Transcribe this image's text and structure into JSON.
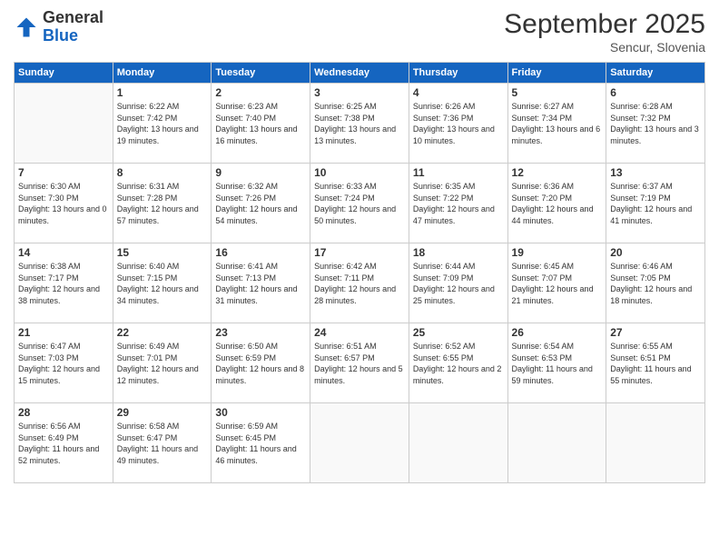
{
  "logo": {
    "general": "General",
    "blue": "Blue"
  },
  "header": {
    "month": "September 2025",
    "location": "Sencur, Slovenia"
  },
  "weekdays": [
    "Sunday",
    "Monday",
    "Tuesday",
    "Wednesday",
    "Thursday",
    "Friday",
    "Saturday"
  ],
  "weeks": [
    [
      {
        "day": "",
        "empty": true
      },
      {
        "day": "1",
        "sunrise": "Sunrise: 6:22 AM",
        "sunset": "Sunset: 7:42 PM",
        "daylight": "Daylight: 13 hours and 19 minutes."
      },
      {
        "day": "2",
        "sunrise": "Sunrise: 6:23 AM",
        "sunset": "Sunset: 7:40 PM",
        "daylight": "Daylight: 13 hours and 16 minutes."
      },
      {
        "day": "3",
        "sunrise": "Sunrise: 6:25 AM",
        "sunset": "Sunset: 7:38 PM",
        "daylight": "Daylight: 13 hours and 13 minutes."
      },
      {
        "day": "4",
        "sunrise": "Sunrise: 6:26 AM",
        "sunset": "Sunset: 7:36 PM",
        "daylight": "Daylight: 13 hours and 10 minutes."
      },
      {
        "day": "5",
        "sunrise": "Sunrise: 6:27 AM",
        "sunset": "Sunset: 7:34 PM",
        "daylight": "Daylight: 13 hours and 6 minutes."
      },
      {
        "day": "6",
        "sunrise": "Sunrise: 6:28 AM",
        "sunset": "Sunset: 7:32 PM",
        "daylight": "Daylight: 13 hours and 3 minutes."
      }
    ],
    [
      {
        "day": "7",
        "sunrise": "Sunrise: 6:30 AM",
        "sunset": "Sunset: 7:30 PM",
        "daylight": "Daylight: 13 hours and 0 minutes."
      },
      {
        "day": "8",
        "sunrise": "Sunrise: 6:31 AM",
        "sunset": "Sunset: 7:28 PM",
        "daylight": "Daylight: 12 hours and 57 minutes."
      },
      {
        "day": "9",
        "sunrise": "Sunrise: 6:32 AM",
        "sunset": "Sunset: 7:26 PM",
        "daylight": "Daylight: 12 hours and 54 minutes."
      },
      {
        "day": "10",
        "sunrise": "Sunrise: 6:33 AM",
        "sunset": "Sunset: 7:24 PM",
        "daylight": "Daylight: 12 hours and 50 minutes."
      },
      {
        "day": "11",
        "sunrise": "Sunrise: 6:35 AM",
        "sunset": "Sunset: 7:22 PM",
        "daylight": "Daylight: 12 hours and 47 minutes."
      },
      {
        "day": "12",
        "sunrise": "Sunrise: 6:36 AM",
        "sunset": "Sunset: 7:20 PM",
        "daylight": "Daylight: 12 hours and 44 minutes."
      },
      {
        "day": "13",
        "sunrise": "Sunrise: 6:37 AM",
        "sunset": "Sunset: 7:19 PM",
        "daylight": "Daylight: 12 hours and 41 minutes."
      }
    ],
    [
      {
        "day": "14",
        "sunrise": "Sunrise: 6:38 AM",
        "sunset": "Sunset: 7:17 PM",
        "daylight": "Daylight: 12 hours and 38 minutes."
      },
      {
        "day": "15",
        "sunrise": "Sunrise: 6:40 AM",
        "sunset": "Sunset: 7:15 PM",
        "daylight": "Daylight: 12 hours and 34 minutes."
      },
      {
        "day": "16",
        "sunrise": "Sunrise: 6:41 AM",
        "sunset": "Sunset: 7:13 PM",
        "daylight": "Daylight: 12 hours and 31 minutes."
      },
      {
        "day": "17",
        "sunrise": "Sunrise: 6:42 AM",
        "sunset": "Sunset: 7:11 PM",
        "daylight": "Daylight: 12 hours and 28 minutes."
      },
      {
        "day": "18",
        "sunrise": "Sunrise: 6:44 AM",
        "sunset": "Sunset: 7:09 PM",
        "daylight": "Daylight: 12 hours and 25 minutes."
      },
      {
        "day": "19",
        "sunrise": "Sunrise: 6:45 AM",
        "sunset": "Sunset: 7:07 PM",
        "daylight": "Daylight: 12 hours and 21 minutes."
      },
      {
        "day": "20",
        "sunrise": "Sunrise: 6:46 AM",
        "sunset": "Sunset: 7:05 PM",
        "daylight": "Daylight: 12 hours and 18 minutes."
      }
    ],
    [
      {
        "day": "21",
        "sunrise": "Sunrise: 6:47 AM",
        "sunset": "Sunset: 7:03 PM",
        "daylight": "Daylight: 12 hours and 15 minutes."
      },
      {
        "day": "22",
        "sunrise": "Sunrise: 6:49 AM",
        "sunset": "Sunset: 7:01 PM",
        "daylight": "Daylight: 12 hours and 12 minutes."
      },
      {
        "day": "23",
        "sunrise": "Sunrise: 6:50 AM",
        "sunset": "Sunset: 6:59 PM",
        "daylight": "Daylight: 12 hours and 8 minutes."
      },
      {
        "day": "24",
        "sunrise": "Sunrise: 6:51 AM",
        "sunset": "Sunset: 6:57 PM",
        "daylight": "Daylight: 12 hours and 5 minutes."
      },
      {
        "day": "25",
        "sunrise": "Sunrise: 6:52 AM",
        "sunset": "Sunset: 6:55 PM",
        "daylight": "Daylight: 12 hours and 2 minutes."
      },
      {
        "day": "26",
        "sunrise": "Sunrise: 6:54 AM",
        "sunset": "Sunset: 6:53 PM",
        "daylight": "Daylight: 11 hours and 59 minutes."
      },
      {
        "day": "27",
        "sunrise": "Sunrise: 6:55 AM",
        "sunset": "Sunset: 6:51 PM",
        "daylight": "Daylight: 11 hours and 55 minutes."
      }
    ],
    [
      {
        "day": "28",
        "sunrise": "Sunrise: 6:56 AM",
        "sunset": "Sunset: 6:49 PM",
        "daylight": "Daylight: 11 hours and 52 minutes."
      },
      {
        "day": "29",
        "sunrise": "Sunrise: 6:58 AM",
        "sunset": "Sunset: 6:47 PM",
        "daylight": "Daylight: 11 hours and 49 minutes."
      },
      {
        "day": "30",
        "sunrise": "Sunrise: 6:59 AM",
        "sunset": "Sunset: 6:45 PM",
        "daylight": "Daylight: 11 hours and 46 minutes."
      },
      {
        "day": "",
        "empty": true
      },
      {
        "day": "",
        "empty": true
      },
      {
        "day": "",
        "empty": true
      },
      {
        "day": "",
        "empty": true
      }
    ]
  ]
}
